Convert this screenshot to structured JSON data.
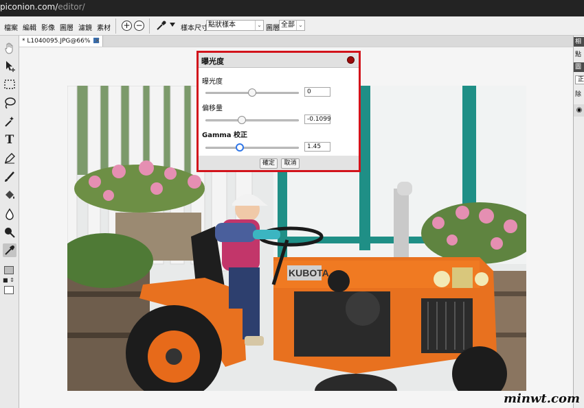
{
  "browser": {
    "url_main": "piconion.com/",
    "url_path": "editor/"
  },
  "menu": [
    "檔案",
    "編輯",
    "影像",
    "圖層",
    "濾鏡",
    "素材"
  ],
  "options": {
    "zoom_in": "+",
    "zoom_out": "−",
    "sample_size_label": "樣本尺寸",
    "sample_size_value": "點狀樣本",
    "layer_label": "圖層",
    "layer_value": "全部"
  },
  "document_tab": {
    "title": "* L1040095.JPG@66%",
    "close": "×"
  },
  "right_panel": {
    "header1": "相",
    "item1": "點",
    "header2": "圖",
    "field": "正",
    "item2": "除"
  },
  "dialog": {
    "title": "曝光度",
    "params": [
      {
        "label": "曝光度",
        "value": "0",
        "position": 0.5
      },
      {
        "label": "偏移量",
        "value": "-0.1099",
        "position": 0.39
      },
      {
        "label": "Gamma 校正",
        "value": "1.45",
        "position": 0.37
      }
    ],
    "ok": "確定",
    "cancel": "取消"
  },
  "photo": {
    "plate_text": "KUBOTA"
  },
  "watermark": "minwt.com"
}
